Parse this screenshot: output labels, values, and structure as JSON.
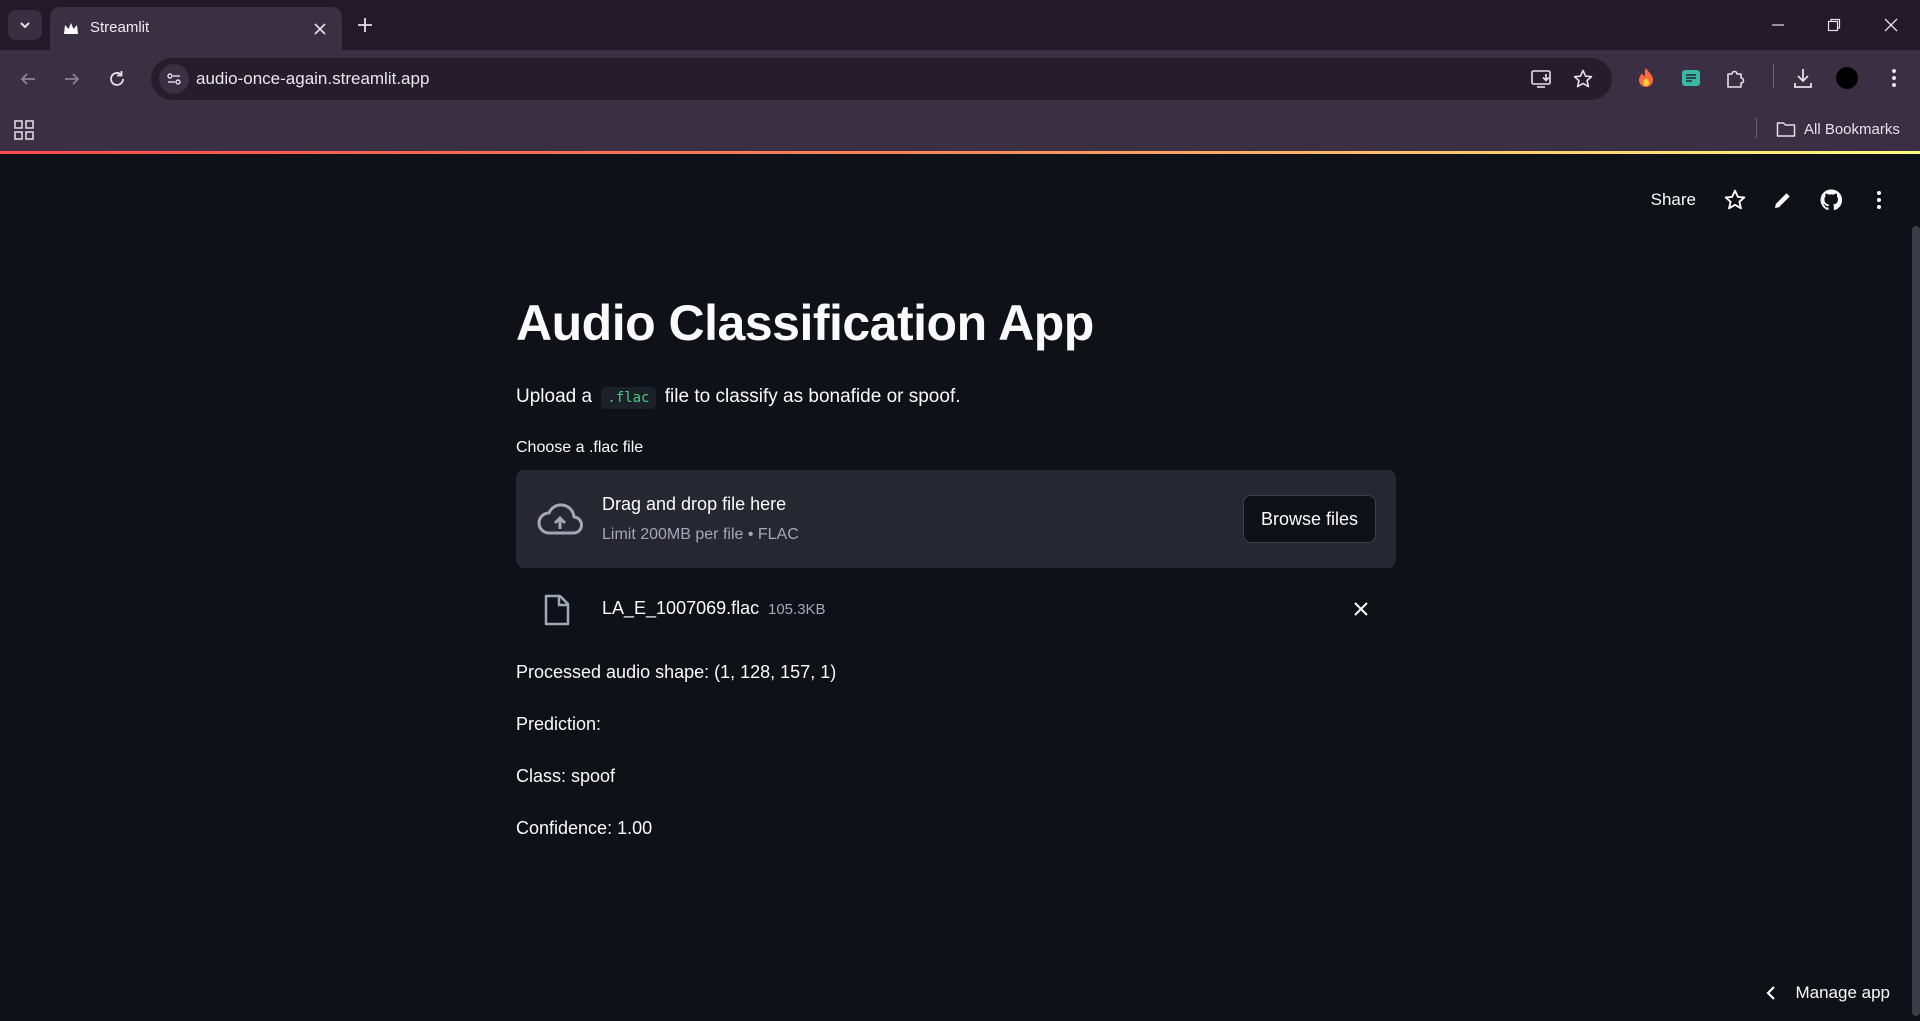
{
  "browser": {
    "tab_title": "Streamlit",
    "url": "audio-once-again.streamlit.app",
    "bookmarks_label": "All Bookmarks"
  },
  "app": {
    "header": {
      "share_label": "Share"
    },
    "title": "Audio Classification App",
    "caption": {
      "prefix": "Upload a",
      "code": ".flac",
      "suffix": "file to classify as bonafide or spoof."
    },
    "uploader": {
      "label": "Choose a .flac file",
      "drop_text": "Drag and drop file here",
      "limit_text": "Limit 200MB per file • FLAC",
      "browse_label": "Browse files"
    },
    "file": {
      "name": "LA_E_1007069.flac",
      "size": "105.3KB"
    },
    "results": {
      "shape": "Processed audio shape: (1, 128, 157, 1)",
      "prediction": "Prediction:",
      "class": "Class: spoof",
      "confidence": "Confidence: 1.00"
    },
    "manage_label": "Manage app"
  },
  "colors": {
    "app_background": "#0e1117",
    "dropzone_background": "#262730",
    "code_text": "#4ec97a",
    "chrome_background": "#3b2f44",
    "streamlit_accent": "#ff4b4b"
  },
  "icons": [
    "tab-search-icon",
    "streamlit-crown-icon",
    "close-icon",
    "plus-icon",
    "minimize-icon",
    "restore-icon",
    "back-icon",
    "forward-icon",
    "reload-icon",
    "site-info-icon",
    "install-icon",
    "star-icon",
    "extension-icons",
    "download-icon",
    "profile-icon",
    "more-icon",
    "apps-icon",
    "folder-icon",
    "pencil-icon",
    "github-icon",
    "cloud-upload-icon",
    "file-icon",
    "chevron-left-icon"
  ]
}
